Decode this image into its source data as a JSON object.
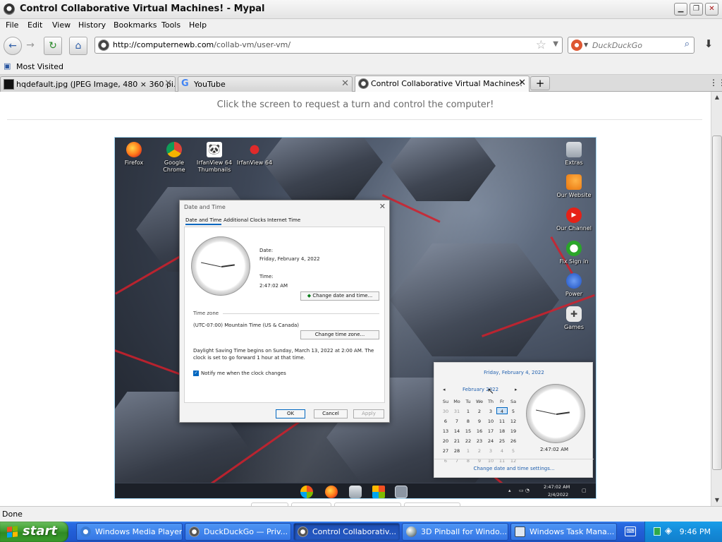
{
  "window": {
    "title": "Control Collaborative Virtual Machines! - Mypal"
  },
  "menu": [
    "File",
    "Edit",
    "View",
    "History",
    "Bookmarks",
    "Tools",
    "Help"
  ],
  "nav": {
    "url_host": "http://computernewb.com",
    "url_path": "/collab-vm/user-vm/",
    "search_placeholder": "DuckDuckGo"
  },
  "bookmarks": {
    "most_visited": "Most Visited"
  },
  "tabs": [
    {
      "label": "hqdefault.jpg (JPEG Image, 480 × 360 pi...",
      "active": false
    },
    {
      "label": "YouTube",
      "active": false
    },
    {
      "label": "Control Collaborative Virtual Machines!",
      "active": true
    }
  ],
  "page": {
    "hint": "Click the screen to request a turn and control the computer!"
  },
  "status": "Done",
  "vm": {
    "desktop_icons_left": [
      "Firefox",
      "Google Chrome",
      "IrfanView 64 Thumbnails",
      "IrfanView 64"
    ],
    "desktop_icons_right": [
      "Extras",
      "Our Website",
      "Our Channel",
      "Fix Sign in",
      "Power",
      "Games"
    ],
    "dialog": {
      "title": "Date and Time",
      "tabs": [
        "Date and Time",
        "Additional Clocks",
        "Internet Time"
      ],
      "date_label": "Date:",
      "date_value": "Friday, February 4, 2022",
      "time_label": "Time:",
      "time_value": "2:47:02 AM",
      "change_dt_button": "Change date and time...",
      "timezone_heading": "Time zone",
      "timezone_value": "(UTC-07:00) Mountain Time (US & Canada)",
      "change_tz_button": "Change time zone...",
      "dst_line1": "Daylight Saving Time begins on Sunday, March 13, 2022 at 2:00 AM. The",
      "dst_line2": "clock is set to go forward 1 hour at that time.",
      "notify_label": "Notify me when the clock changes",
      "notify_checked": true,
      "ok": "OK",
      "cancel": "Cancel",
      "apply": "Apply"
    },
    "calendar": {
      "header": "Friday, February 4, 2022",
      "month": "February 2022",
      "weekdays": [
        "Su",
        "Mo",
        "Tu",
        "We",
        "Th",
        "Fr",
        "Sa"
      ],
      "weeks": [
        [
          "30",
          "31",
          "1",
          "2",
          "3",
          "4",
          "5"
        ],
        [
          "6",
          "7",
          "8",
          "9",
          "10",
          "11",
          "12"
        ],
        [
          "13",
          "14",
          "15",
          "16",
          "17",
          "18",
          "19"
        ],
        [
          "20",
          "21",
          "22",
          "23",
          "24",
          "25",
          "26"
        ],
        [
          "27",
          "28",
          "1",
          "2",
          "3",
          "4",
          "5"
        ],
        [
          "6",
          "7",
          "8",
          "9",
          "10",
          "11",
          "12"
        ]
      ],
      "today": "4",
      "clock_caption": "2:47:02 AM",
      "settings_link": "Change date and time settings..."
    },
    "tray_time": "2:47:02 AM",
    "tray_date": "2/4/2022"
  },
  "xp_taskbar": {
    "start": "start",
    "tasks": [
      {
        "label": "Windows Media Player",
        "active": false
      },
      {
        "label": "DuckDuckGo — Priv...",
        "active": false
      },
      {
        "label": "Control Collaborativ...",
        "active": true
      },
      {
        "label": "3D Pinball for Windo...",
        "active": false
      },
      {
        "label": "Windows Task Mana...",
        "active": false
      }
    ],
    "clock": "9:46 PM"
  },
  "colors": {
    "xp_blue": "#225ed6",
    "start_green": "#3c9a2f",
    "win11_accent": "#0067c0",
    "wallpaper_red": "#d1202b"
  }
}
